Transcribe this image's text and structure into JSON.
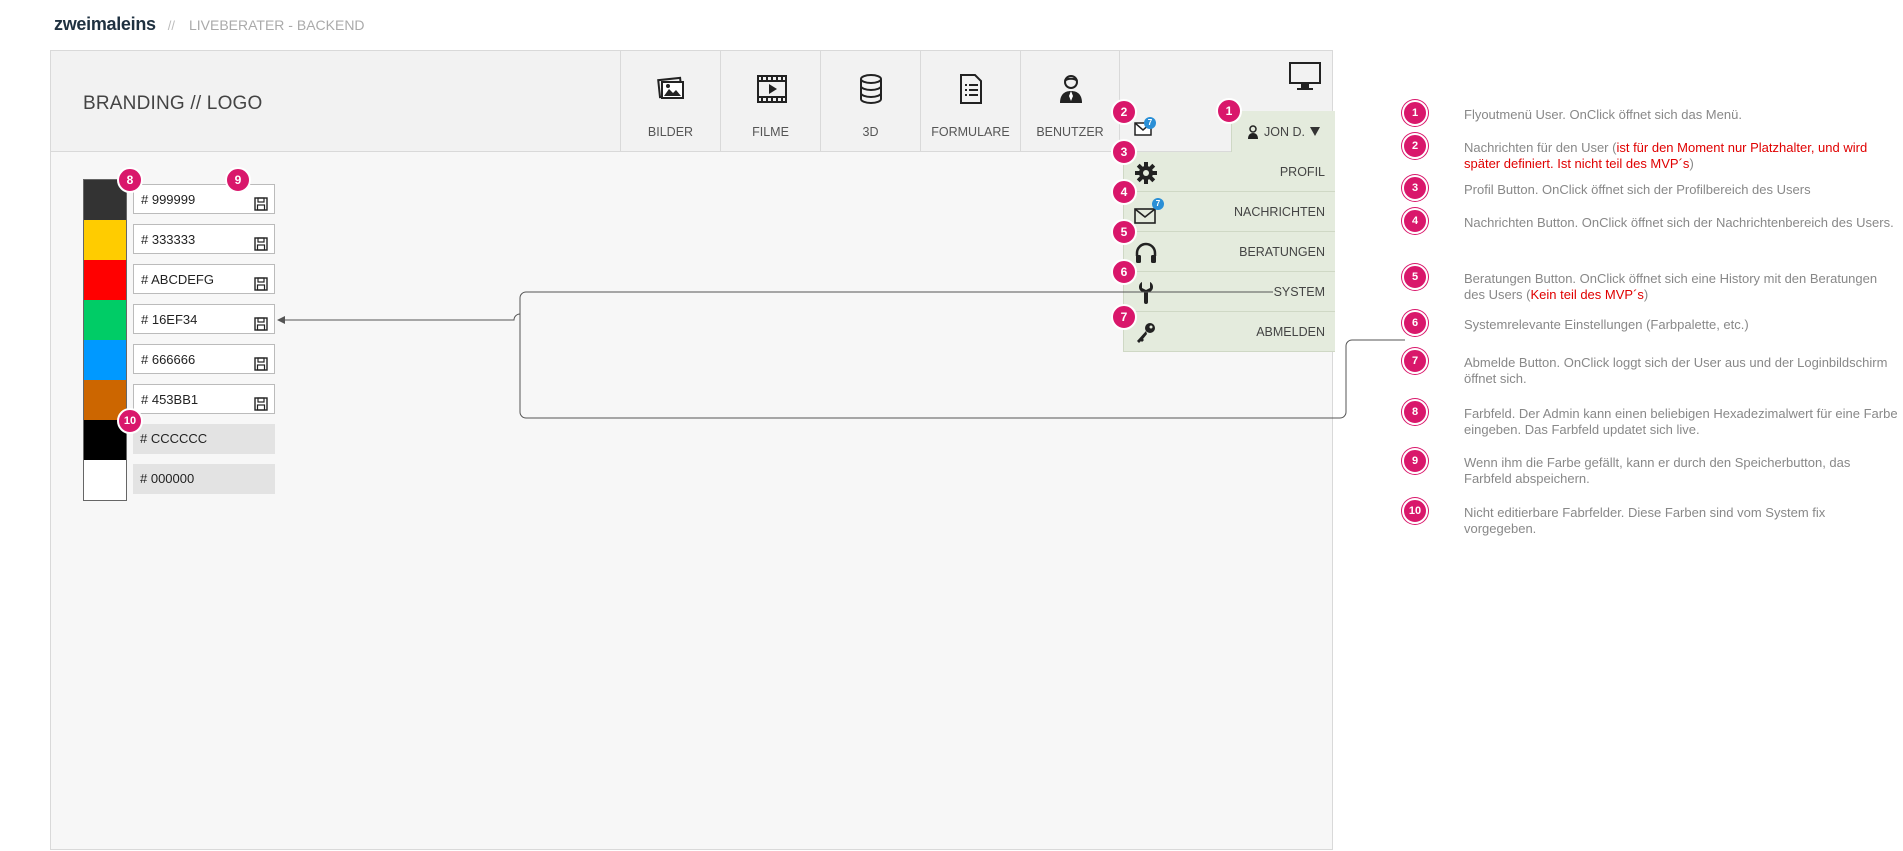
{
  "topbar": {
    "brand": "zweimaleins",
    "separator": "//",
    "subtitle": "LIVEBERATER - BACKEND"
  },
  "header": {
    "logo": "BRANDING // LOGO",
    "nav": [
      {
        "label": "BILDER",
        "icon": "images-icon"
      },
      {
        "label": "FILME",
        "icon": "film-icon"
      },
      {
        "label": "3D",
        "icon": "database-icon"
      },
      {
        "label": "FORMULARE",
        "icon": "form-icon"
      },
      {
        "label": "BENUTZER",
        "icon": "user-icon"
      }
    ],
    "user_button": "JON D.",
    "message_badge": "7"
  },
  "menu": {
    "items": [
      {
        "label": "PROFIL",
        "icon": "gear-icon"
      },
      {
        "label": "NACHRICHTEN",
        "icon": "mail-icon",
        "badge": "7"
      },
      {
        "label": "BERATUNGEN",
        "icon": "headset-icon"
      },
      {
        "label": "SYSTEM",
        "icon": "wrench-icon"
      },
      {
        "label": "ABMELDEN",
        "icon": "key-icon"
      }
    ]
  },
  "colors": [
    {
      "swatch": "#333333",
      "hex": "# 999999",
      "editable": true
    },
    {
      "swatch": "#ffcc00",
      "hex": "# 333333",
      "editable": true
    },
    {
      "swatch": "#ff0000",
      "hex": "# ABCDEFG",
      "editable": true
    },
    {
      "swatch": "#00cc66",
      "hex": "# 16EF34",
      "editable": true
    },
    {
      "swatch": "#0099ff",
      "hex": "# 666666",
      "editable": true
    },
    {
      "swatch": "#cc6600",
      "hex": "# 453BB1",
      "editable": true
    },
    {
      "swatch": "#000000",
      "hex": "# CCCCCC",
      "editable": false
    },
    {
      "swatch": "#ffffff",
      "hex": "# 000000",
      "editable": false
    }
  ],
  "markers": [
    "1",
    "2",
    "3",
    "4",
    "5",
    "6",
    "7",
    "8",
    "9",
    "10"
  ],
  "legend": [
    {
      "num": "1",
      "text": "Flyoutmenü User. OnClick öffnet sich das Menü."
    },
    {
      "num": "2",
      "text": "Nachrichten für den User (",
      "red": "ist für den Moment nur Platzhalter, und wird später definiert. Ist nicht teil des MVP´s",
      "tail": ")"
    },
    {
      "num": "3",
      "text": "Profil Button. OnClick öffnet sich der Profilbereich des Users"
    },
    {
      "num": "4",
      "text": "Nachrichten Button. OnClick öffnet sich der Nachrichtenbereich des Users."
    },
    {
      "num": "5",
      "text": "Beratungen Button. OnClick öffnet sich eine History mit den Beratungen des Users (",
      "red": "Kein teil des MVP´s",
      "tail": ")"
    },
    {
      "num": "6",
      "text": "Systemrelevante Einstellungen (Farbpalette, etc.)"
    },
    {
      "num": "7",
      "text": "Abmelde Button. OnClick loggt sich der User aus und der Loginbildschirm öffnet sich."
    },
    {
      "num": "8",
      "text": "Farbfeld. Der Admin kann einen beliebigen Hexadezimalwert für eine Farbe eingeben. Das Farbfeld updatet sich live."
    },
    {
      "num": "9",
      "text": "Wenn ihm die Farbe gefällt, kann er durch den Speicherbutton, das Farbfeld abspeichern."
    },
    {
      "num": "10",
      "text": "Nicht editierbare Fabrfelder. Diese Farben sind vom System fix vorgegeben."
    }
  ]
}
